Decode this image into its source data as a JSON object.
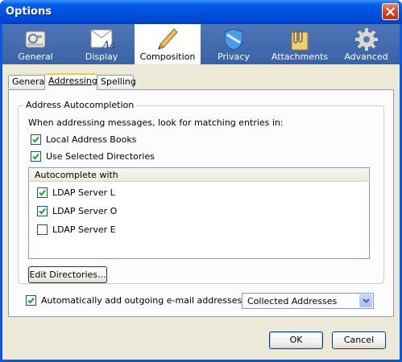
{
  "window": {
    "title": "Options"
  },
  "categories": [
    {
      "label": "General",
      "icon": "general-icon"
    },
    {
      "label": "Display",
      "icon": "display-icon"
    },
    {
      "label": "Composition",
      "icon": "composition-icon",
      "selected": true
    },
    {
      "label": "Privacy",
      "icon": "privacy-icon"
    },
    {
      "label": "Attachments",
      "icon": "attachments-icon"
    },
    {
      "label": "Advanced",
      "icon": "advanced-icon"
    }
  ],
  "tabs": [
    {
      "label": "General"
    },
    {
      "label": "Addressing",
      "active": true
    },
    {
      "label": "Spelling"
    }
  ],
  "autocomplete": {
    "group_title": "Address Autocompletion",
    "intro": "When addressing messages, look for matching entries in:",
    "local_books": {
      "label": "Local Address Books",
      "checked": true
    },
    "use_directories": {
      "label": "Use Selected Directories",
      "checked": true
    },
    "list_header": "Autocomplete with",
    "servers": [
      {
        "label": "LDAP Server L",
        "checked": true
      },
      {
        "label": "LDAP Server O",
        "checked": true
      },
      {
        "label": "LDAP Server E",
        "checked": false
      }
    ],
    "edit_button": "Edit Directories..."
  },
  "auto_add": {
    "label": "Automatically add outgoing e-mail addresses to my:",
    "checked": true,
    "selected": "Collected Addresses"
  },
  "buttons": {
    "ok": "OK",
    "cancel": "Cancel"
  }
}
